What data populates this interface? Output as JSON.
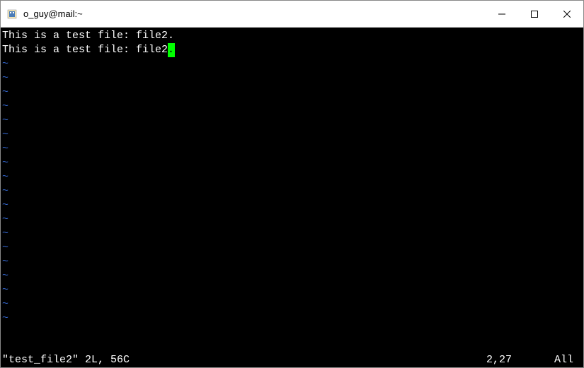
{
  "window": {
    "title": "o_guy@mail:~"
  },
  "editor": {
    "lines": [
      "This is a test file: file2.",
      "This is a test file: file2"
    ],
    "cursor_char": ".",
    "tilde": "~"
  },
  "status": {
    "filename": "\"test_file2\" 2L, 56C",
    "position": "2,27",
    "view": "All"
  }
}
